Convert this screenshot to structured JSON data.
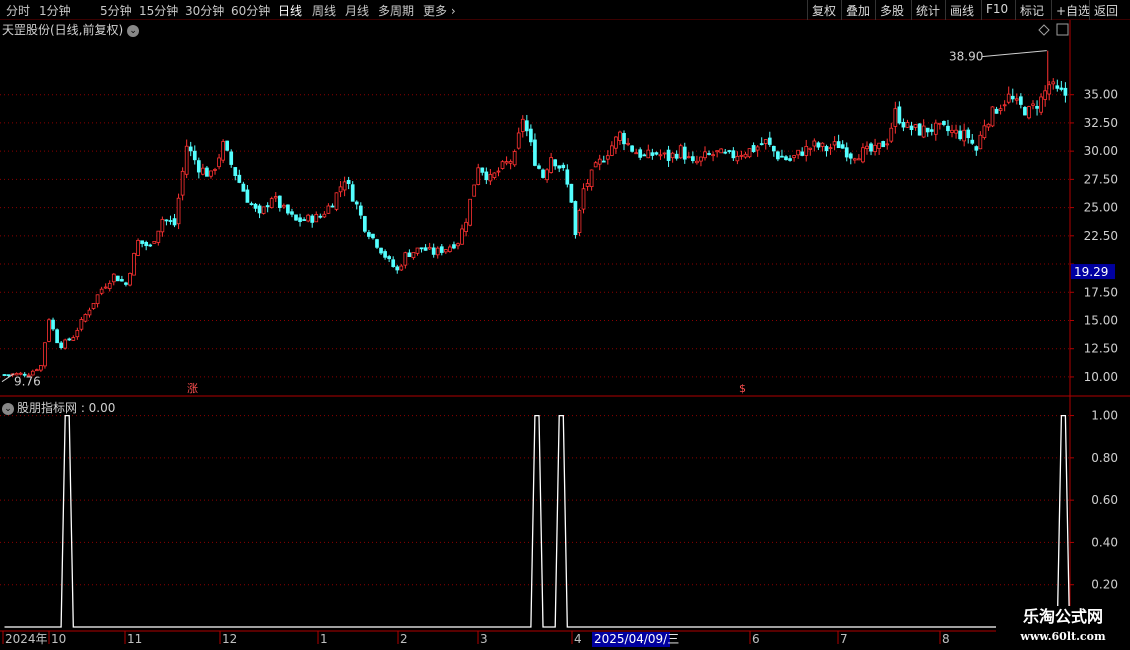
{
  "toolbar": {
    "periods": [
      "分时",
      "1分钟",
      "5分钟",
      "15分钟",
      "30分钟",
      "60分钟",
      "日线",
      "周线",
      "月线",
      "多周期",
      "更多"
    ],
    "active_period": "日线",
    "right_buttons": [
      "复权",
      "叠加",
      "多股",
      "统计",
      "画线",
      "F10",
      "标记",
      "+自选",
      "返回"
    ]
  },
  "main_chart": {
    "title": "天罡股份(日线,前复权)",
    "high_marker": "38.90",
    "low_marker": "9.76",
    "current_price_tag": "19.29",
    "note_1": "涨",
    "note_2": "$"
  },
  "indicator": {
    "title": "股朋指标网 : 0.00"
  },
  "date_axis": {
    "labels": [
      "2024年",
      "10",
      "11",
      "12",
      "1",
      "2",
      "3",
      "4",
      "6",
      "7",
      "8"
    ],
    "cursor_date": "2025/04/09/三"
  },
  "brand": {
    "name": "乐淘公式网",
    "url": "www.60lt.com"
  },
  "colors": {
    "up": "#ff3232",
    "down": "#54ffff",
    "grid": "#8b0000",
    "axis": "#b00000"
  },
  "chart_data": [
    {
      "type": "candlestick",
      "title": "天罡股份(日线,前复权)",
      "y_ticks": [
        35.0,
        32.5,
        30.0,
        27.5,
        25.0,
        22.5,
        20.0,
        17.5,
        15.0,
        12.5,
        10.0
      ],
      "y_tick_labels": [
        "35.00",
        "32.50",
        "30.00",
        "27.50",
        "25.00",
        "22.50",
        "",
        "17.50",
        "15.00",
        "12.50",
        "10.00"
      ],
      "ylim": [
        8.4,
        40.2
      ],
      "x_labels": [
        "2024年",
        "10",
        "11",
        "12",
        "1",
        "2",
        "3",
        "4",
        "6",
        "7",
        "8"
      ],
      "close_path": [
        [
          0,
          10.2
        ],
        [
          6,
          10.3
        ],
        [
          9,
          11.0
        ],
        [
          11,
          15.2
        ],
        [
          13,
          13.2
        ],
        [
          14,
          12.8
        ],
        [
          17,
          13.6
        ],
        [
          20,
          15.5
        ],
        [
          24,
          17.8
        ],
        [
          27,
          19.0
        ],
        [
          30,
          18.2
        ],
        [
          33,
          22.0
        ],
        [
          36,
          21.5
        ],
        [
          39,
          24.0
        ],
        [
          42,
          23.5
        ],
        [
          45,
          30.5
        ],
        [
          48,
          28.6
        ],
        [
          51,
          27.8
        ],
        [
          54,
          30.5
        ],
        [
          57,
          28.0
        ],
        [
          60,
          25.8
        ],
        [
          63,
          24.2
        ],
        [
          66,
          26.0
        ],
        [
          69,
          24.8
        ],
        [
          72,
          23.8
        ],
        [
          75,
          24.0
        ],
        [
          78,
          24.2
        ],
        [
          81,
          25.5
        ],
        [
          84,
          27.6
        ],
        [
          87,
          25.2
        ],
        [
          89,
          23.3
        ],
        [
          92,
          21.8
        ],
        [
          95,
          20.2
        ],
        [
          97,
          19.4
        ],
        [
          99,
          20.8
        ],
        [
          103,
          21.4
        ],
        [
          106,
          21.0
        ],
        [
          109,
          21.4
        ],
        [
          112,
          22.0
        ],
        [
          114,
          24.0
        ],
        [
          117,
          28.8
        ],
        [
          120,
          27.5
        ],
        [
          123,
          28.6
        ],
        [
          126,
          29.5
        ],
        [
          128,
          33.0
        ],
        [
          131,
          29.2
        ],
        [
          133,
          27.8
        ],
        [
          135,
          29.6
        ],
        [
          138,
          28.2
        ],
        [
          140,
          25.7
        ],
        [
          141,
          22.5
        ],
        [
          143,
          26.6
        ],
        [
          146,
          28.5
        ],
        [
          149,
          30.0
        ],
        [
          152,
          31.5
        ],
        [
          155,
          30.2
        ],
        [
          158,
          29.5
        ],
        [
          161,
          29.8
        ],
        [
          164,
          29.4
        ],
        [
          167,
          30.1
        ],
        [
          170,
          28.8
        ],
        [
          173,
          29.5
        ],
        [
          176,
          29.8
        ],
        [
          179,
          29.5
        ],
        [
          182,
          29.9
        ],
        [
          185,
          30.2
        ],
        [
          188,
          30.8
        ],
        [
          191,
          29.6
        ],
        [
          194,
          29.2
        ],
        [
          197,
          30.0
        ],
        [
          200,
          30.5
        ],
        [
          203,
          30.2
        ],
        [
          206,
          30.6
        ],
        [
          209,
          29.7
        ],
        [
          212,
          29.9
        ],
        [
          215,
          30.0
        ],
        [
          218,
          31.0
        ],
        [
          220,
          33.4
        ],
        [
          223,
          32.1
        ],
        [
          226,
          31.8
        ],
        [
          229,
          32.0
        ],
        [
          232,
          31.9
        ],
        [
          235,
          31.6
        ],
        [
          238,
          31.3
        ],
        [
          240,
          30.1
        ],
        [
          242,
          32.5
        ],
        [
          245,
          33.8
        ],
        [
          248,
          34.8
        ],
        [
          250,
          34.1
        ],
        [
          253,
          33.5
        ],
        [
          256,
          34.6
        ],
        [
          258,
          35.9
        ],
        [
          260,
          35.2
        ],
        [
          262,
          35.0
        ]
      ],
      "high_marker": 38.9,
      "low_marker": 9.76,
      "current_price_tag": 19.29
    },
    {
      "type": "line",
      "title": "股朋指标网",
      "series": [
        {
          "name": "股朋指标网",
          "x": [
            0,
            14,
            15,
            16,
            17,
            130,
            131,
            132,
            133,
            136,
            137,
            138,
            139,
            260,
            261,
            262,
            263
          ],
          "values": [
            0,
            0,
            1,
            1,
            0,
            0,
            1,
            1,
            0,
            0,
            1,
            1,
            0,
            0,
            1,
            1,
            0
          ]
        }
      ],
      "y_ticks": [
        1.0,
        0.8,
        0.6,
        0.4,
        0.2
      ],
      "y_tick_labels": [
        "1.00",
        "0.80",
        "0.60",
        "0.40",
        "0.20"
      ],
      "ylim": [
        0,
        1.05
      ]
    }
  ]
}
